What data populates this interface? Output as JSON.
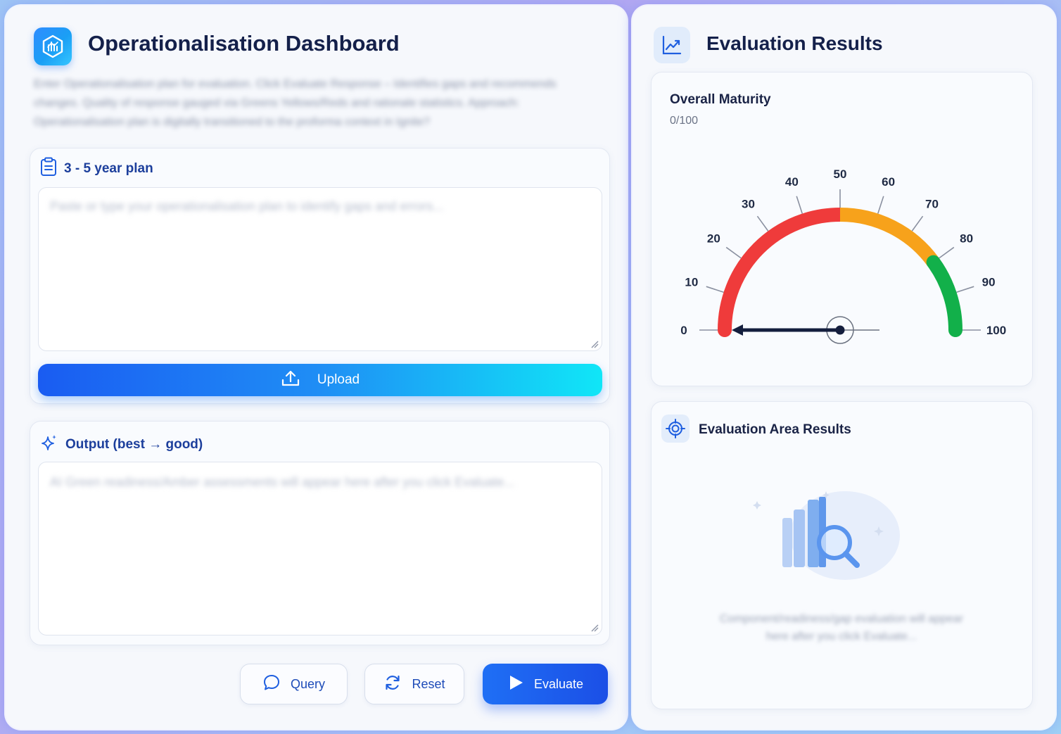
{
  "left": {
    "title": "Operationalisation Dashboard",
    "description": "Enter Operationalisation plan for evaluation. Click Evaluate Response – Identifies gaps and recommends changes. Quality of response gauged via Greens Yellows/Reds and rationale statistics. Approach: Operationalisation plan is digitally transitioned to the proforma context in Ignite?",
    "plan": {
      "label": "3 - 5 year plan",
      "placeholder": "Paste or type your operationalisation plan to identify gaps and errors..."
    },
    "upload_label": "Upload",
    "output": {
      "label": "Output (best → good)",
      "placeholder": "AI Green readiness/Amber assessments will appear here after you click Evaluate..."
    },
    "buttons": {
      "query": "Query",
      "reset": "Reset",
      "evaluate": "Evaluate"
    }
  },
  "right": {
    "title": "Evaluation Results",
    "maturity": {
      "label": "Overall Maturity",
      "score_text": "0/100",
      "value": 0,
      "max": 100,
      "ticks": [
        "0",
        "10",
        "20",
        "30",
        "40",
        "50",
        "60",
        "70",
        "80",
        "90",
        "100"
      ],
      "bands": [
        {
          "from": 0,
          "to": 50,
          "color": "#ef3b3b"
        },
        {
          "from": 50,
          "to": 80,
          "color": "#f7a21b"
        },
        {
          "from": 80,
          "to": 100,
          "color": "#12b04a"
        }
      ]
    },
    "area": {
      "title": "Evaluation Area Results",
      "empty_text": "Component/readiness/gap evaluation will appear here after you click Evaluate..."
    }
  },
  "colors": {
    "accent": "#1f6ff5",
    "title": "#14204a",
    "label_blue": "#1d3f9c"
  }
}
